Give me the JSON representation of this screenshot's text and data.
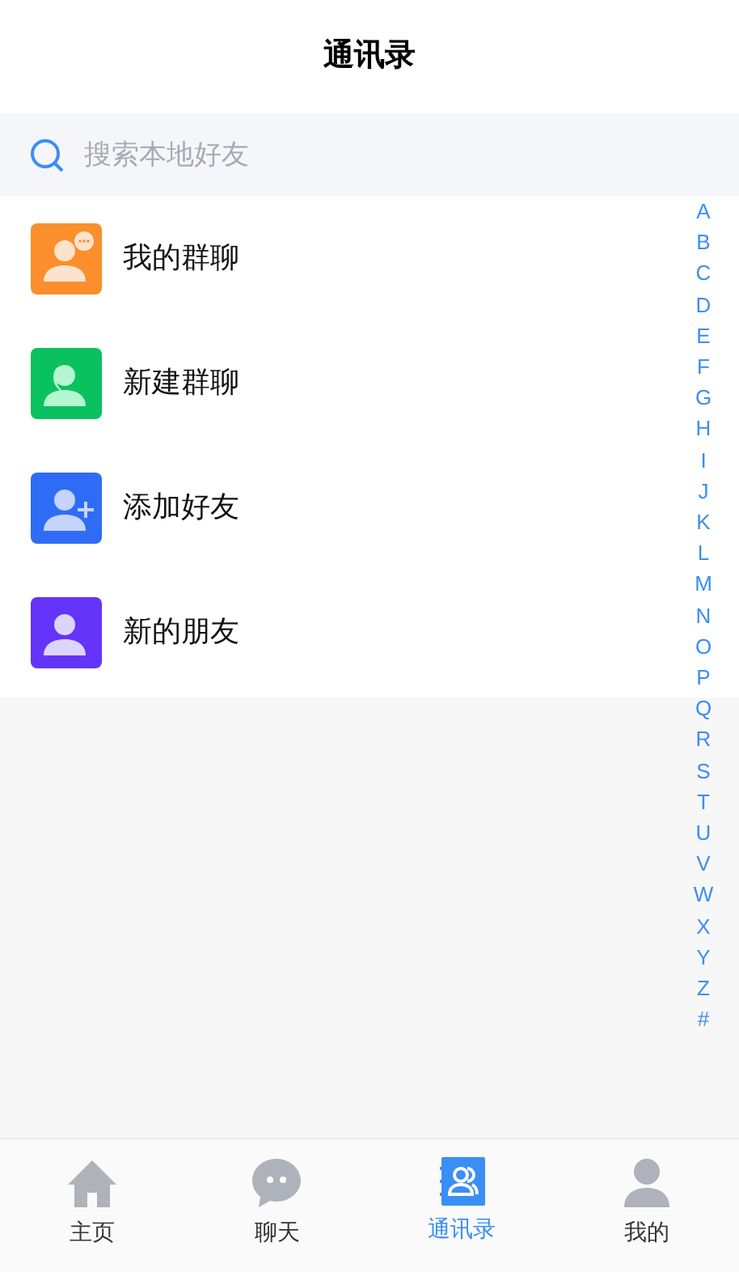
{
  "header": {
    "title": "通讯录"
  },
  "search": {
    "placeholder": "搜索本地好友"
  },
  "entries": [
    {
      "kind": "group-chat",
      "label": "我的群聊",
      "color": "#fa8f2c"
    },
    {
      "kind": "new-group",
      "label": "新建群聊",
      "color": "#0ac160"
    },
    {
      "kind": "add-friend",
      "label": "添加好友",
      "color": "#2f6cf6"
    },
    {
      "kind": "new-friend",
      "label": "新的朋友",
      "color": "#6434f9"
    }
  ],
  "index": [
    "A",
    "B",
    "C",
    "D",
    "E",
    "F",
    "G",
    "H",
    "I",
    "J",
    "K",
    "L",
    "M",
    "N",
    "O",
    "P",
    "Q",
    "R",
    "S",
    "T",
    "U",
    "V",
    "W",
    "X",
    "Y",
    "Z",
    "#"
  ],
  "tabs": [
    {
      "kind": "home",
      "label": "主页",
      "selected": false
    },
    {
      "kind": "chat",
      "label": "聊天",
      "selected": false
    },
    {
      "kind": "contacts",
      "label": "通讯录",
      "selected": true
    },
    {
      "kind": "me",
      "label": "我的",
      "selected": false
    }
  ]
}
